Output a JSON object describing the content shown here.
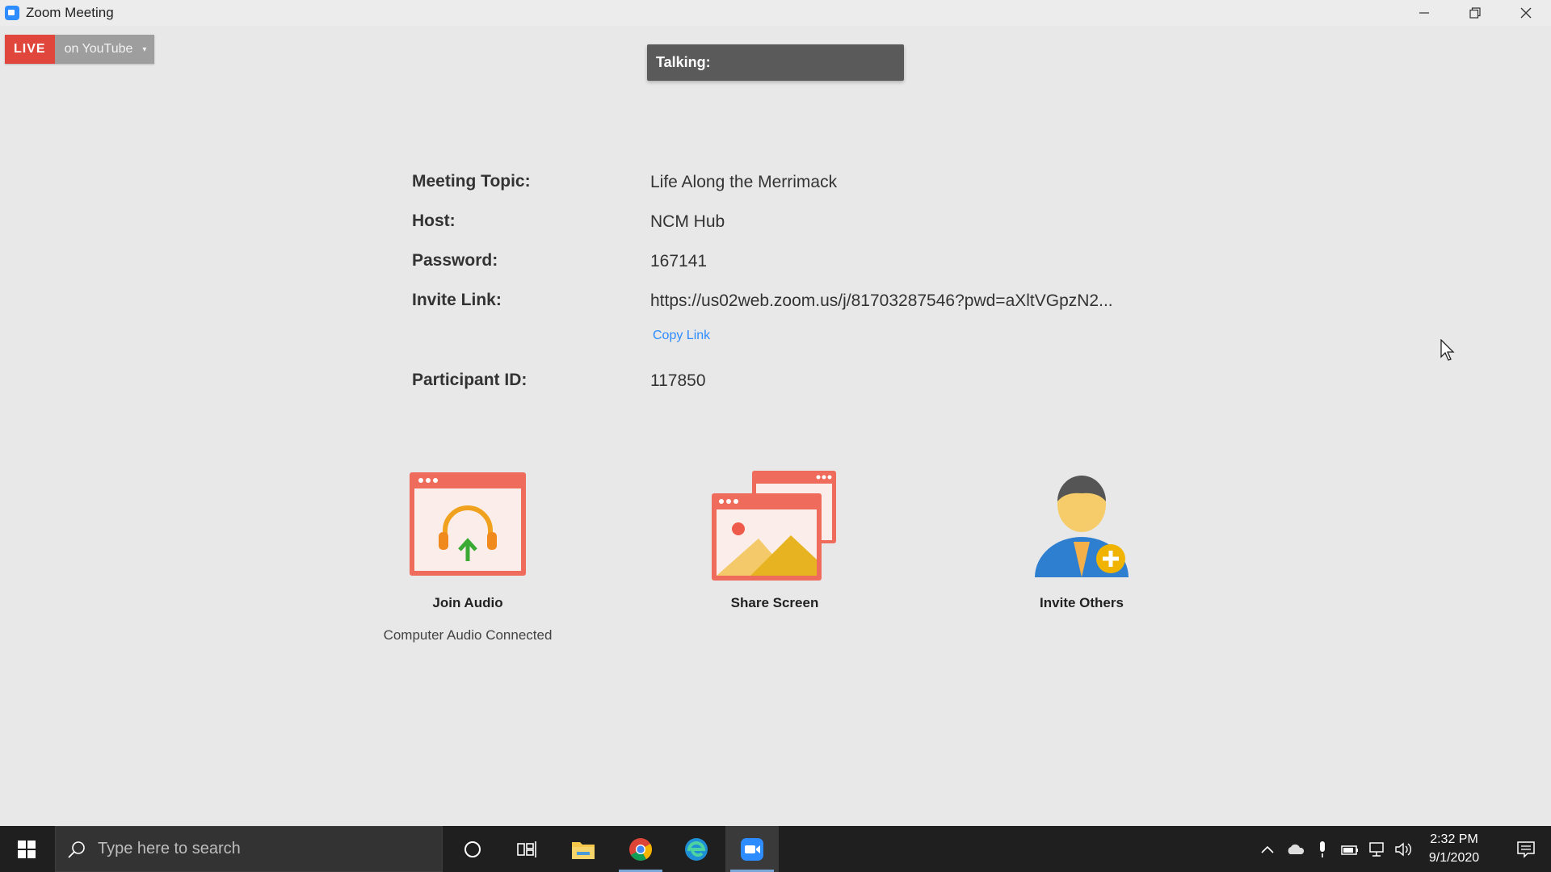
{
  "window": {
    "title": "Zoom Meeting"
  },
  "live": {
    "badge": "LIVE",
    "destination": "on YouTube",
    "caret": "▾"
  },
  "talking": {
    "label": "Talking:"
  },
  "meeting_info": {
    "topic_label": "Meeting Topic:",
    "topic_value": "Life Along the Merrimack",
    "host_label": "Host:",
    "host_value": "NCM Hub",
    "password_label": "Password:",
    "password_value": "167141",
    "invite_label": "Invite Link:",
    "invite_value": "https://us02web.zoom.us/j/81703287546?pwd=aXltVGpzN2...",
    "copy_link": "Copy Link",
    "participant_label": "Participant ID:",
    "participant_value": "117850"
  },
  "actions": {
    "join_audio": {
      "label": "Join Audio",
      "status": "Computer Audio Connected",
      "icon": "headphones-upload-icon"
    },
    "share_screen": {
      "label": "Share Screen",
      "icon": "share-screen-icon"
    },
    "invite_others": {
      "label": "Invite Others",
      "icon": "invite-person-icon"
    }
  },
  "colors": {
    "live_red": "#e0463c",
    "link_blue": "#2d8cff",
    "tile_red": "#ef6b5b"
  },
  "taskbar": {
    "search_placeholder": "Type here to search",
    "apps": [
      "cortana-icon",
      "task-view-icon",
      "file-explorer-icon",
      "chrome-icon",
      "edge-icon",
      "zoom-icon"
    ],
    "tray_icons": [
      "chevron-up-icon",
      "cloud-icon",
      "microphone-icon",
      "battery-icon",
      "network-icon",
      "volume-icon"
    ],
    "time": "2:32 PM",
    "date": "9/1/2020"
  }
}
